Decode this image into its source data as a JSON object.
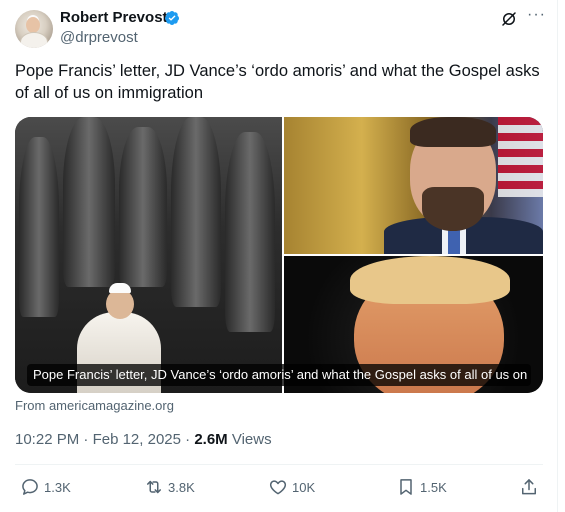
{
  "author": {
    "name": "Robert Prevost",
    "handle": "@drprevost",
    "verified": true
  },
  "tweet": {
    "text": "Pope Francis’ letter, JD Vance’s ‘ordo amoris’ and what the Gospel asks of all of us on immigration"
  },
  "card": {
    "caption": "Pope Francis’ letter, JD Vance’s ‘ordo amoris’ and what the Gospel asks of all of us on i...",
    "source": "From americamagazine.org"
  },
  "meta": {
    "time": "10:22 PM",
    "date": "Feb 12, 2025",
    "views_count": "2.6M",
    "views_label": "Views"
  },
  "actions": {
    "replies": "1.3K",
    "reposts": "3.8K",
    "likes": "10K",
    "bookmarks": "1.5K"
  },
  "colors": {
    "verified_badge": "#1d9bf0",
    "secondary_text": "#536471",
    "primary_text": "#0f1419"
  },
  "icons": [
    "grok-icon",
    "more-icon",
    "reply-icon",
    "repost-icon",
    "like-icon",
    "bookmark-icon",
    "share-icon",
    "verified-icon"
  ]
}
